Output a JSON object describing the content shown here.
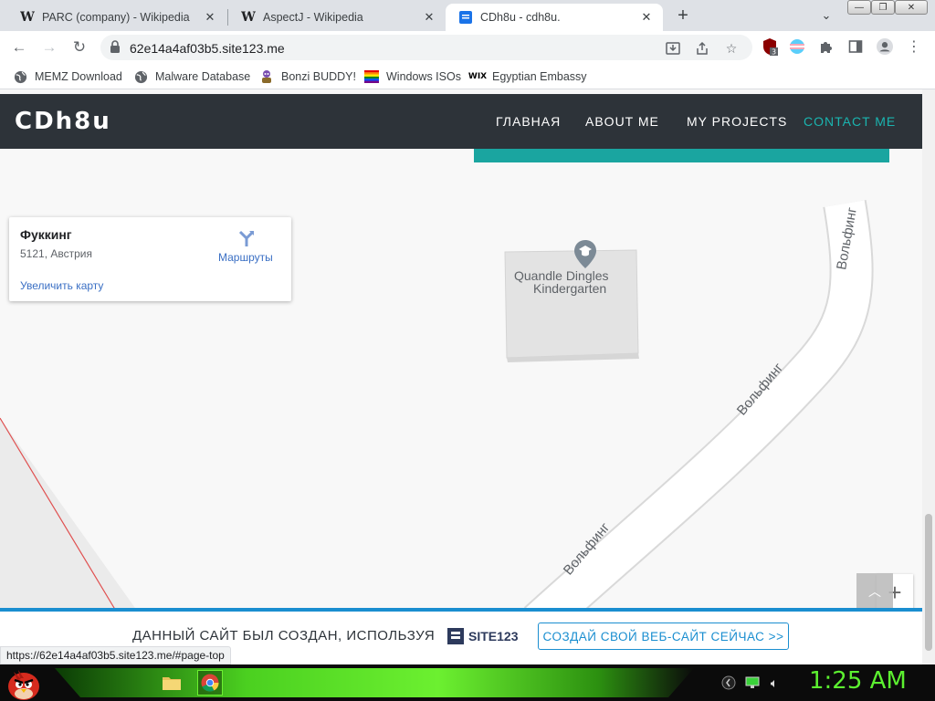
{
  "browser": {
    "tabs": [
      {
        "title": "PARC (company) - Wikipedia",
        "favicon": "W"
      },
      {
        "title": "AspectJ - Wikipedia",
        "favicon": "W"
      },
      {
        "title": "CDh8u - cdh8u.",
        "favicon": "site123-icon"
      }
    ],
    "url": "62e14a4af03b5.site123.me",
    "extension_badge": "3"
  },
  "bookmarks": [
    {
      "label": "MEMZ Download",
      "icon": "globe-icon"
    },
    {
      "label": "Malware Database",
      "icon": "globe-icon"
    },
    {
      "label": "Bonzi BUDDY!",
      "icon": "bonzi-icon"
    },
    {
      "label": "Windows ISOs",
      "icon": "rainbow-flag-icon"
    },
    {
      "label": "Egyptian Embassy",
      "icon": "wix-icon"
    }
  ],
  "site": {
    "logo": "CDh8u",
    "nav": [
      "ГЛАВНАЯ",
      "ABOUT ME",
      "MY PROJECTS",
      "CONTACT ME"
    ],
    "active_nav": "CONTACT ME",
    "accent": "#1ab5b0"
  },
  "map": {
    "place_name": "Фуккинг",
    "address": "5121, Австрия",
    "directions_label": "Маршруты",
    "enlarge_label": "Увеличить карту",
    "poi_line1": "Quandle Dingles",
    "poi_line2": "Kindergarten",
    "road_name": "Вольфинг",
    "road_name_2": "Вольфинг",
    "road_name_3": "Вольфинг"
  },
  "banner": {
    "text": "ДАННЫЙ САЙТ БЫЛ СОЗДАН, ИСПОЛЬЗУЯ",
    "brand": "SITE123",
    "cta": "СОЗДАЙ СВОЙ ВЕБ-САЙТ СЕЙЧАС >>"
  },
  "status_url": "https://62e14a4af03b5.site123.me/#page-top",
  "taskbar": {
    "clock": "1:25 AM"
  }
}
